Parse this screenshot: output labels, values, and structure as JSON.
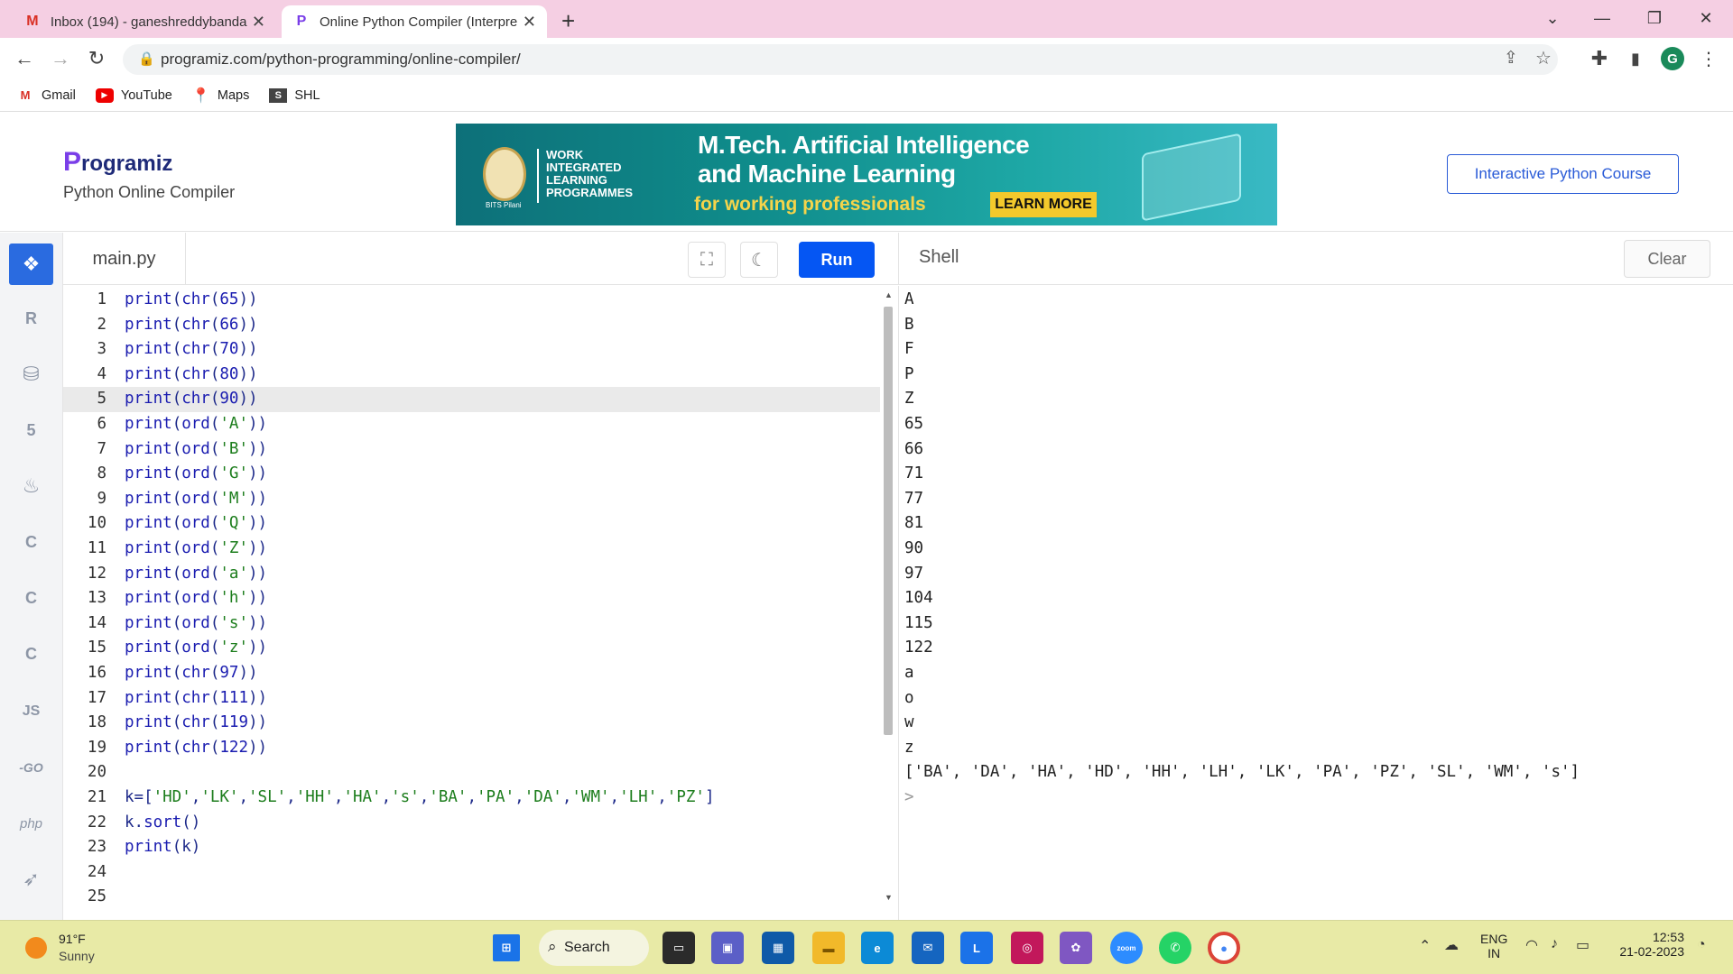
{
  "browser": {
    "tabs": [
      {
        "title": "Inbox (194) - ganeshreddybanda",
        "active": false
      },
      {
        "title": "Online Python Compiler (Interpre",
        "active": true
      }
    ],
    "new_tab": "+",
    "address": "programiz.com/python-programming/online-compiler/",
    "profile_initial": "G",
    "bookmarks": [
      "Gmail",
      "YouTube",
      "Maps",
      "SHL"
    ]
  },
  "site": {
    "logo_mark": "P",
    "logo_text": "rogramiz",
    "subtitle": "Python Online Compiler",
    "ad": {
      "org_lines": [
        "WORK",
        "INTEGRATED",
        "LEARNING",
        "PROGRAMMES"
      ],
      "badge": "BITS Pilani",
      "headline1": "M.Tech. Artificial Intelligence",
      "headline2": "and Machine Learning",
      "tagline": "for working professionals",
      "cta": "LEARN MORE"
    },
    "course_button": "Interactive Python Course"
  },
  "sidebar": {
    "items": [
      {
        "icon": "python-icon",
        "label": "",
        "active": true
      },
      {
        "icon": "r-icon",
        "label": "R",
        "active": false
      },
      {
        "icon": "sql-icon",
        "label": "",
        "active": false
      },
      {
        "icon": "html5-icon",
        "label": "5",
        "active": false
      },
      {
        "icon": "java-icon",
        "label": "",
        "active": false
      },
      {
        "icon": "c-icon",
        "label": "C",
        "active": false
      },
      {
        "icon": "cpp-icon",
        "label": "C",
        "active": false
      },
      {
        "icon": "csharp-icon",
        "label": "C",
        "active": false
      },
      {
        "icon": "javascript-icon",
        "label": "JS",
        "active": false
      },
      {
        "icon": "go-icon",
        "label": "-GO",
        "active": false
      },
      {
        "icon": "php-icon",
        "label": "php",
        "active": false
      },
      {
        "icon": "swift-icon",
        "label": "",
        "active": false
      }
    ]
  },
  "editor": {
    "filename": "main.py",
    "run_label": "Run",
    "current_line": 5,
    "lines": [
      "print(chr(65))",
      "print(chr(66))",
      "print(chr(70))",
      "print(chr(80))",
      "print(chr(90))",
      "print(ord('A'))",
      "print(ord('B'))",
      "print(ord('G'))",
      "print(ord('M'))",
      "print(ord('Q'))",
      "print(ord('Z'))",
      "print(ord('a'))",
      "print(ord('h'))",
      "print(ord('s'))",
      "print(ord('z'))",
      "print(chr(97))",
      "print(chr(111))",
      "print(chr(119))",
      "print(chr(122))",
      "",
      "k=['HD','LK','SL','HH','HA','s','BA','PA','DA','WM','LH','PZ']",
      "k.sort()",
      "print(k)",
      "",
      ""
    ]
  },
  "shell": {
    "title": "Shell",
    "clear_label": "Clear",
    "output": [
      "A",
      "B",
      "F",
      "P",
      "Z",
      "65",
      "66",
      "71",
      "77",
      "81",
      "90",
      "97",
      "104",
      "115",
      "122",
      "a",
      "o",
      "w",
      "z",
      "['BA', 'DA', 'HA', 'HD', 'HH', 'LH', 'LK', 'PA', 'PZ', 'SL', 'WM', 's']",
      ">"
    ]
  },
  "taskbar": {
    "weather_temp": "91°F",
    "weather_desc": "Sunny",
    "search_label": "Search",
    "lang_top": "ENG",
    "lang_bottom": "IN",
    "time": "12:53",
    "date": "21-02-2023"
  },
  "colors": {
    "accent": "#0556f3",
    "tabstrip": "#f5cfe3",
    "taskbar": "#e8eaa6"
  }
}
